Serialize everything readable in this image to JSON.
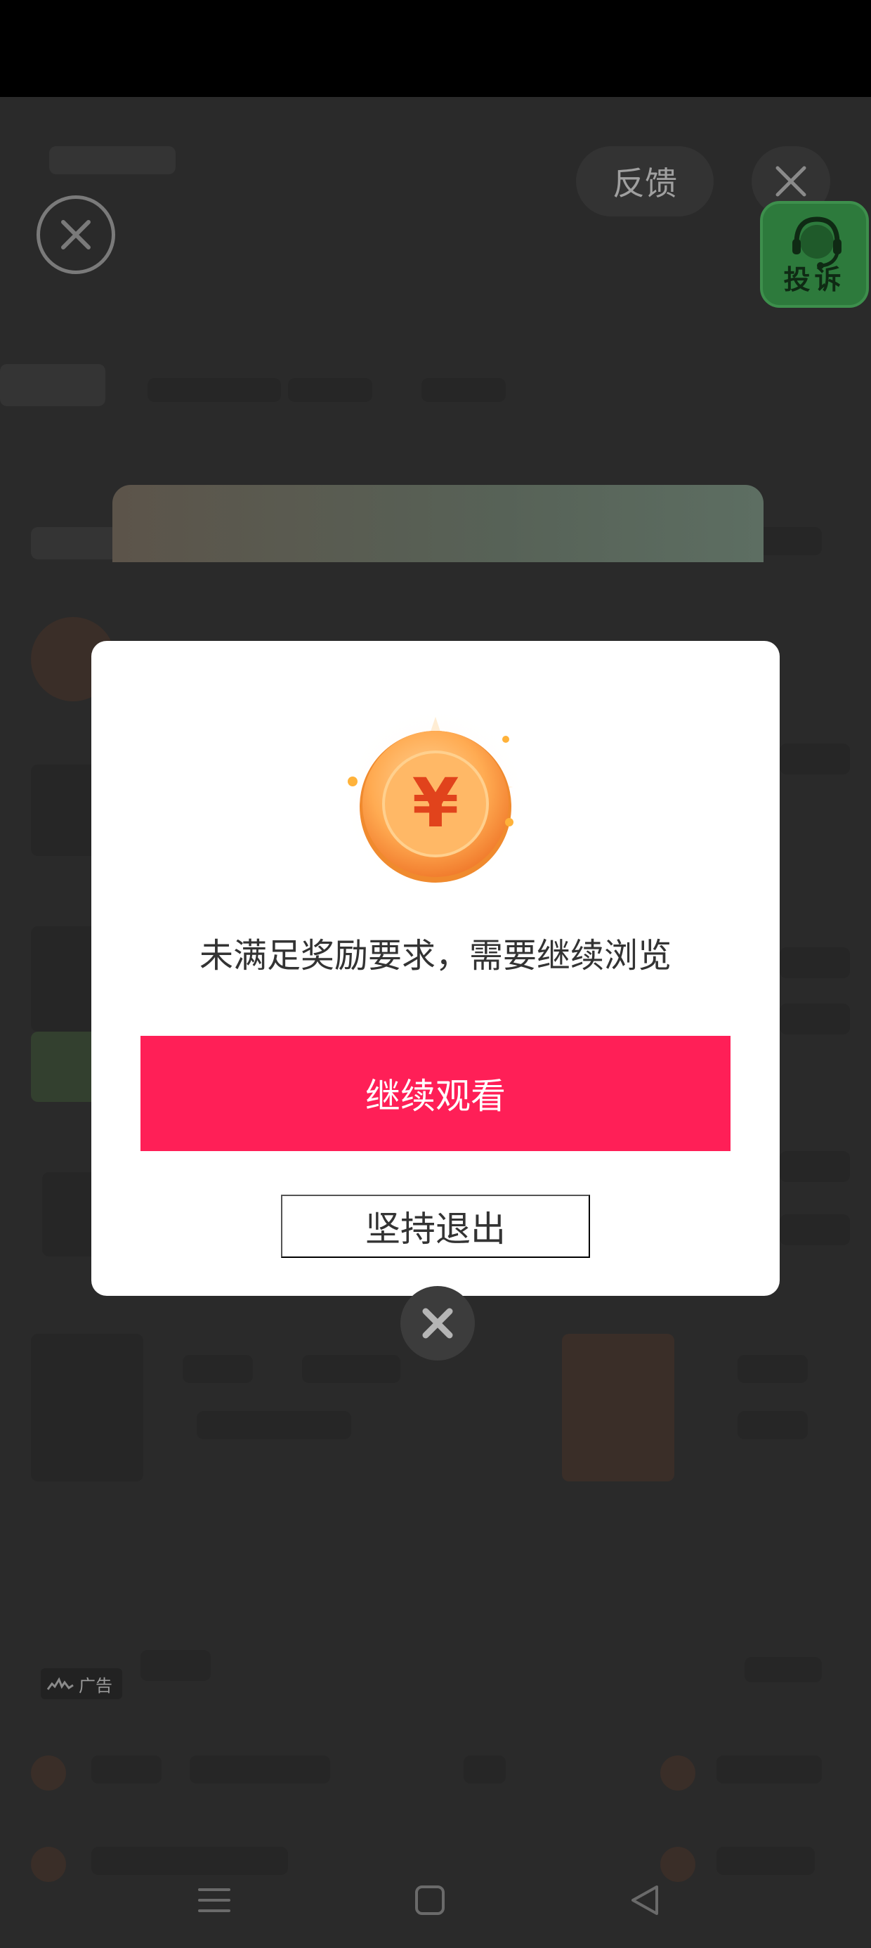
{
  "top_controls": {
    "feedback_label": "反馈",
    "complaint_label": "投诉"
  },
  "ad_tag": {
    "label": "广告"
  },
  "modal": {
    "message": "未满足奖励要求，需要继续浏览",
    "continue_label": "继续观看",
    "exit_label": "坚持退出",
    "coin_symbol": "¥",
    "accent_color": "#ff1f57"
  },
  "icons": {
    "close_top_left": "close-circle-icon",
    "close_top_right": "close-icon",
    "complaint": "headset-icon",
    "close_bottom": "close-circle-icon",
    "nav_menu": "menu-icon",
    "nav_home": "home-icon",
    "nav_back": "back-icon"
  }
}
